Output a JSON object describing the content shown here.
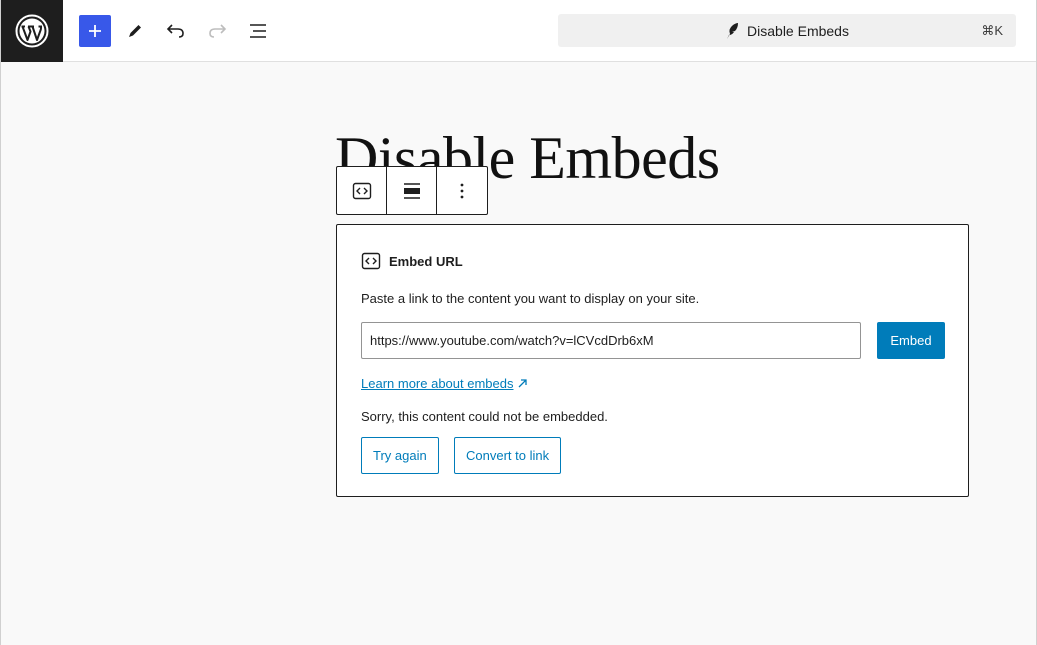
{
  "header": {
    "command_title": "Disable Embeds",
    "command_shortcut": "⌘K"
  },
  "post": {
    "title": "Disable Embeds"
  },
  "embed": {
    "heading": "Embed URL",
    "description": "Paste a link to the content you want to display on your site.",
    "url_value": "https://www.youtube.com/watch?v=lCVcdDrb6xM",
    "embed_button": "Embed",
    "learn_more": "Learn more about embeds",
    "error": "Sorry, this content could not be embedded.",
    "try_again": "Try again",
    "convert": "Convert to link"
  },
  "colors": {
    "accent": "#3858e9",
    "primary": "#007cba",
    "dark": "#1e1e1e"
  }
}
